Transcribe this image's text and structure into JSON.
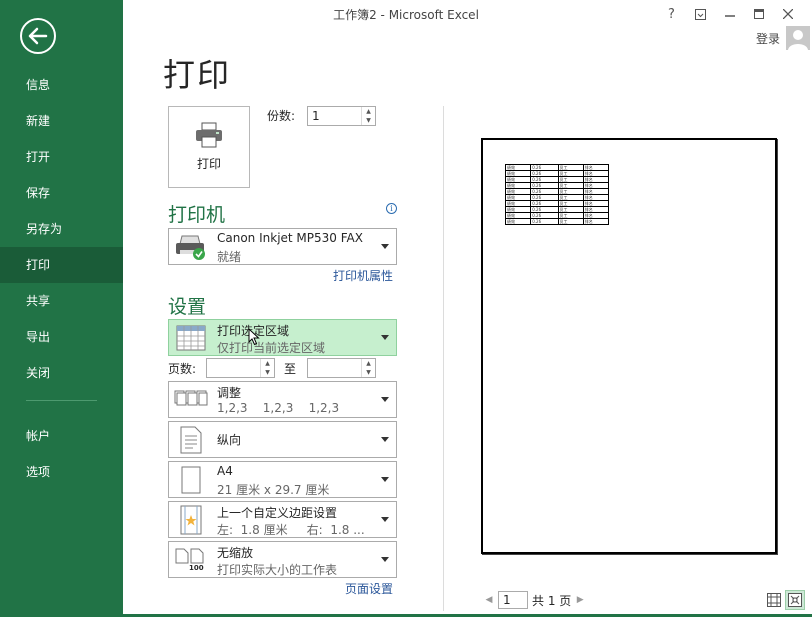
{
  "window": {
    "title": "工作簿2 - Microsoft Excel",
    "help": "?",
    "login": "登录"
  },
  "nav": {
    "items": [
      {
        "label": "信息"
      },
      {
        "label": "新建"
      },
      {
        "label": "打开"
      },
      {
        "label": "保存"
      },
      {
        "label": "另存为"
      },
      {
        "label": "打印"
      },
      {
        "label": "共享"
      },
      {
        "label": "导出"
      },
      {
        "label": "关闭"
      }
    ],
    "items2": [
      {
        "label": "帐户"
      },
      {
        "label": "选项"
      }
    ],
    "active": "打印"
  },
  "page": {
    "title": "打印",
    "print_button": "打印",
    "copies_label": "份数:",
    "copies_value": "1"
  },
  "printer": {
    "heading": "打印机",
    "name": "Canon Inkjet MP530 FAX",
    "status": "就绪",
    "properties_link": "打印机属性"
  },
  "settings": {
    "heading": "设置",
    "print_what": {
      "title": "打印选定区域",
      "sub": "仅打印当前选定区域"
    },
    "pages_label": "页数:",
    "pages_to": "至",
    "collate": {
      "title": "调整",
      "sub": "1,2,3    1,2,3    1,2,3"
    },
    "orientation": {
      "title": "纵向"
    },
    "paper": {
      "title": "A4",
      "sub": "21 厘米 x 29.7 厘米"
    },
    "margins": {
      "title": "上一个自定义边距设置",
      "sub": "左:  1.8 厘米     右:  1.8 ..."
    },
    "scaling": {
      "title": "无缩放",
      "sub": "打印实际大小的工作表",
      "icon_text": "100"
    },
    "page_setup_link": "页面设置"
  },
  "preview": {
    "mini_table_rows": [
      [
        "绩效",
        "0.26",
        "员工",
        "排名"
      ],
      [
        "绩效",
        "0.26",
        "员工",
        "排名"
      ],
      [
        "绩效",
        "0.26",
        "员工",
        "排名"
      ],
      [
        "绩效",
        "0.26",
        "员工",
        "排名"
      ],
      [
        "绩效",
        "0.26",
        "员工",
        "排名"
      ],
      [
        "绩效",
        "0.26",
        "员工",
        "排名"
      ],
      [
        "绩效",
        "0.26",
        "员工",
        "排名"
      ],
      [
        "绩效",
        "0.26",
        "员工",
        "排名"
      ],
      [
        "绩效",
        "0.26",
        "员工",
        "排名"
      ],
      [
        "绩效",
        "0.26",
        "员工",
        "排名"
      ]
    ],
    "page_input": "1",
    "page_total": "共 1 页"
  },
  "colors": {
    "brand": "#217346",
    "nav_active": "#1a5c38",
    "highlight": "#c6efce",
    "link": "#2b579a"
  }
}
